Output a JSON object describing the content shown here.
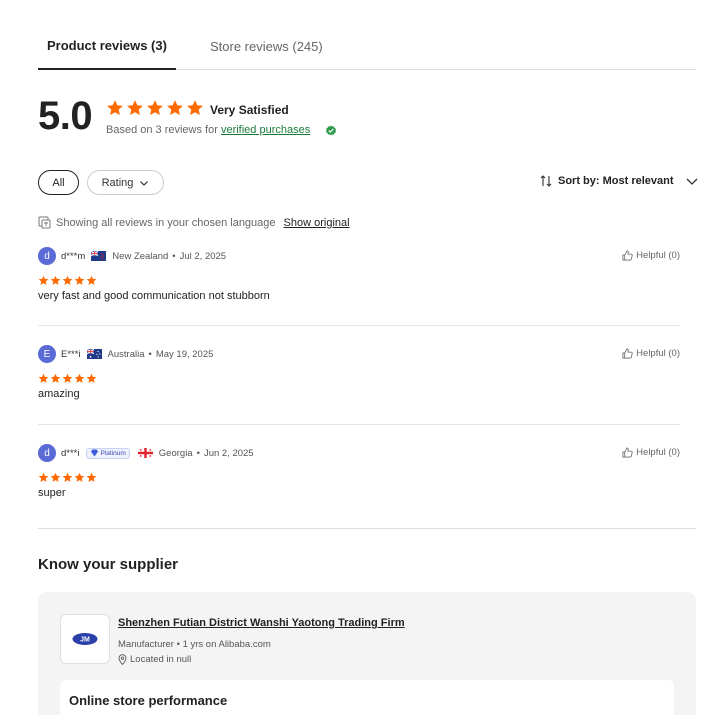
{
  "tabs": {
    "product_reviews": "Product reviews (3)",
    "store_reviews": "Store reviews (245)"
  },
  "summary": {
    "score": "5.0",
    "stars": 5,
    "rating_text": "Very Satisfied",
    "based_on_prefix": "Based on 3 reviews for",
    "verified_link": "verified purchases",
    "star_color": "#ff6a00"
  },
  "filters": {
    "all_label": "All",
    "rating_label": "Rating",
    "sort_label": "Sort by: Most relevant"
  },
  "language_notice": {
    "text": "Showing all reviews in your chosen language",
    "link": "Show original"
  },
  "reviews": [
    {
      "initial": "d",
      "user": "d***m",
      "flag": "new-zealand-flag",
      "country": "New Zealand",
      "date": "Jul 2, 2025",
      "stars": 5,
      "text": "very fast and good communication not stubborn",
      "helpful": "Helpful (0)"
    },
    {
      "initial": "E",
      "user": "E***i",
      "flag": "australia-flag",
      "country": "Australia",
      "date": "May 19, 2025",
      "stars": 5,
      "text": "amazing",
      "helpful": "Helpful (0)"
    },
    {
      "initial": "d",
      "user": "d***i",
      "badge": "Platinum",
      "flag": "georgia-flag",
      "country": "Georgia",
      "date": "Jun 2, 2025",
      "stars": 5,
      "text": "super",
      "helpful": "Helpful (0)"
    }
  ],
  "supplier": {
    "heading": "Know your supplier",
    "name": "Shenzhen Futian District Wanshi Yaotong Trading Firm",
    "meta": "Manufacturer • 1 yrs on Alibaba.com",
    "location": "Located in null",
    "performance_title": "Online store performance",
    "logo_text": "JM"
  }
}
